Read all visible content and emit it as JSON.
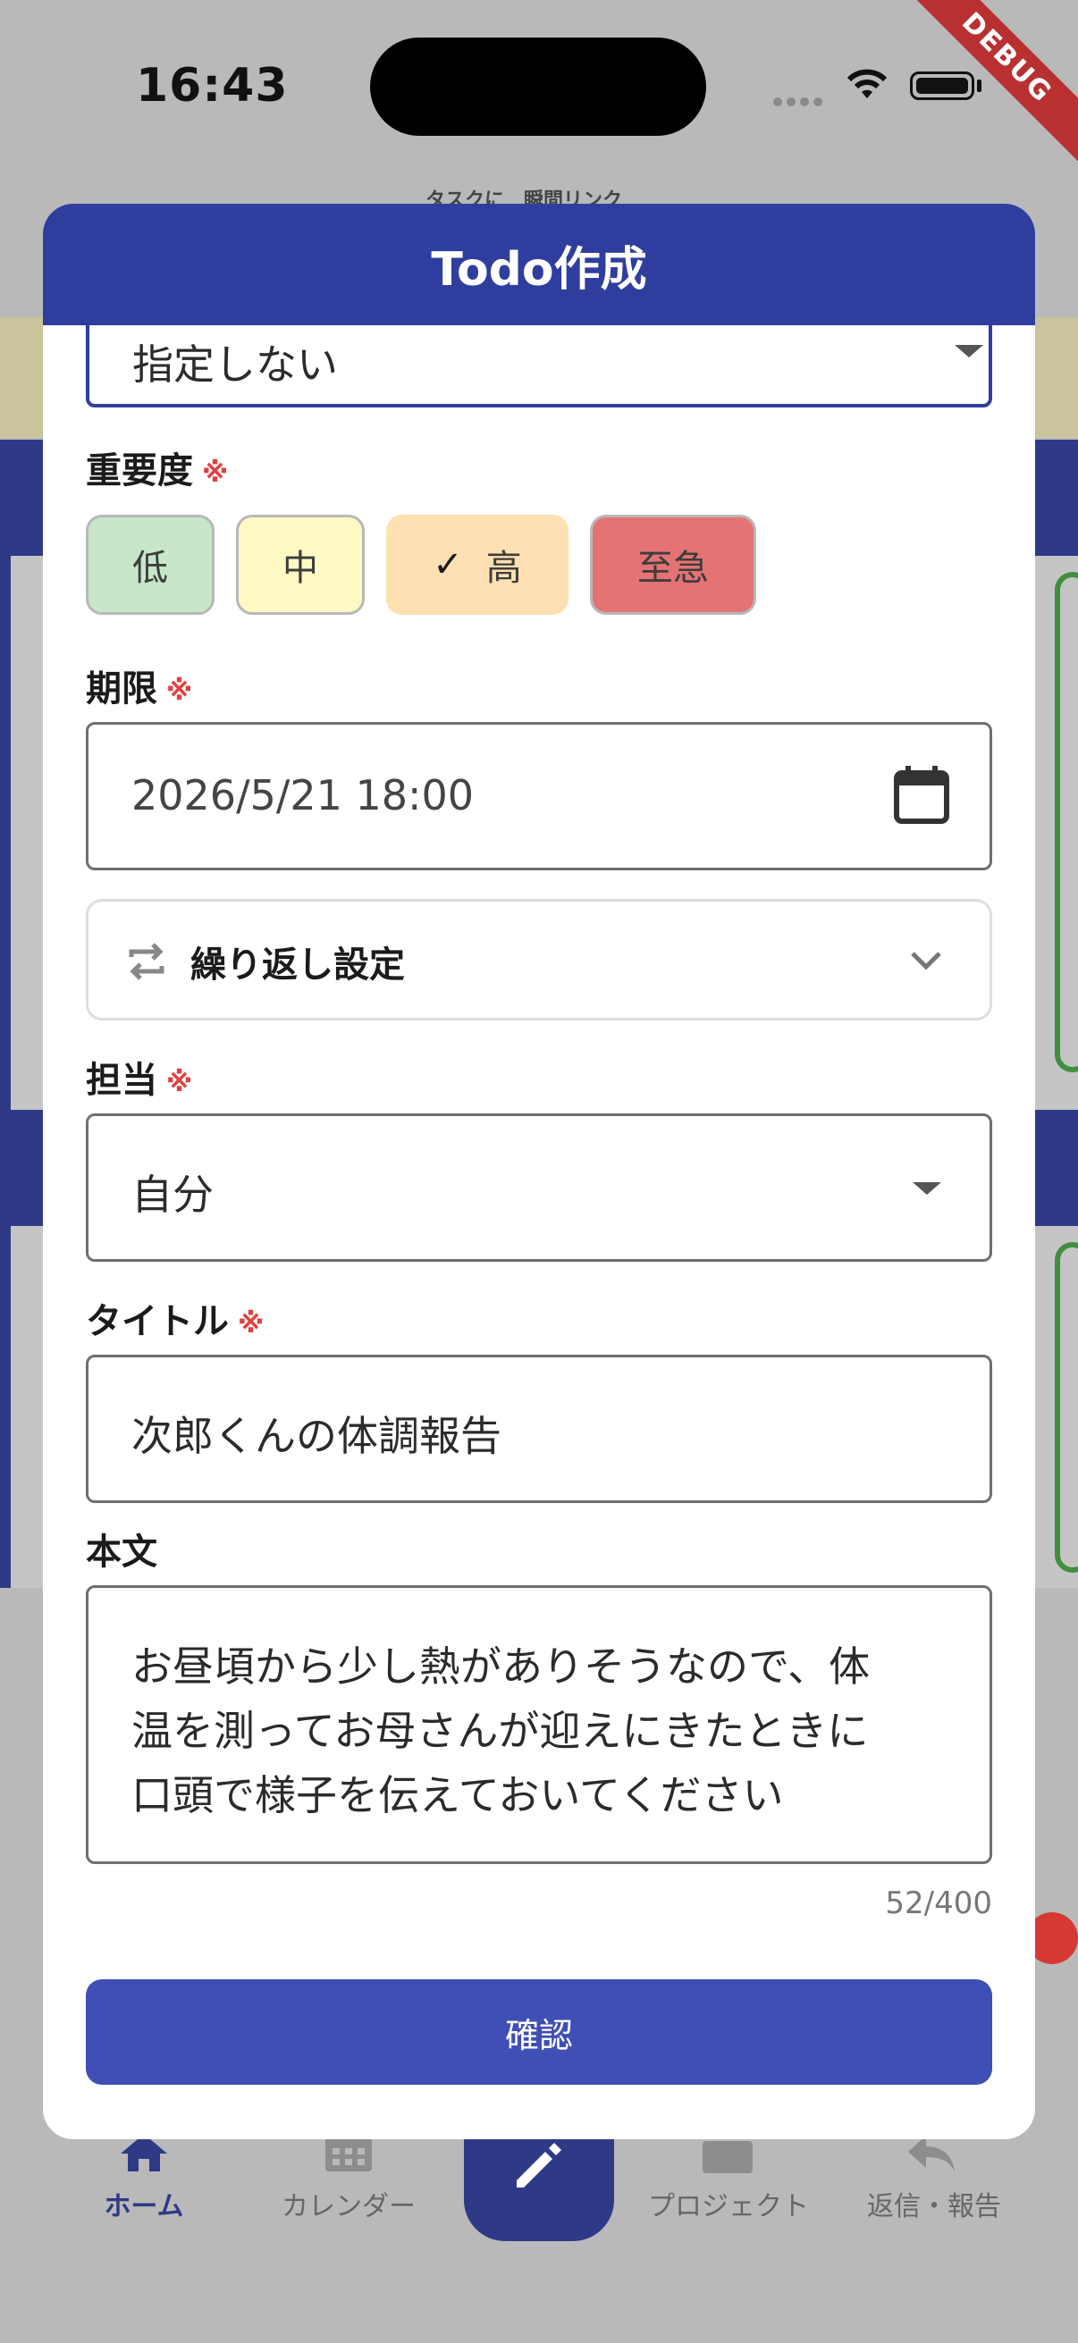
{
  "status_bar": {
    "time": "16:43",
    "debug_label": "DEBUG"
  },
  "background": {
    "banner_text": "タスクに　瞬間リンク"
  },
  "bottom_nav": {
    "items": [
      {
        "label": "ホーム",
        "icon": "home-icon",
        "active": true
      },
      {
        "label": "カレンダー",
        "icon": "calendar-icon",
        "active": false
      },
      {
        "label": "",
        "icon": "edit-icon",
        "active": false
      },
      {
        "label": "プロジェクト",
        "icon": "folder-icon",
        "active": false
      },
      {
        "label": "返信・報告",
        "icon": "reply-icon",
        "active": false
      }
    ]
  },
  "modal": {
    "title": "Todo作成",
    "top_select": {
      "value": "指定しない"
    },
    "importance": {
      "label": "重要度",
      "required_mark": "※",
      "options": [
        {
          "label": "低",
          "color": "#c8e6c9",
          "selected": false
        },
        {
          "label": "中",
          "color": "#fff9c4",
          "selected": false
        },
        {
          "label": "高",
          "color": "#ffe0b2",
          "selected": true
        },
        {
          "label": "至急",
          "color": "#e57373",
          "selected": false
        }
      ],
      "check_mark": "✓"
    },
    "deadline": {
      "label": "期限",
      "required_mark": "※",
      "value": "2026/5/21 18:00"
    },
    "repeat": {
      "label": "繰り返し設定"
    },
    "assignee": {
      "label": "担当",
      "required_mark": "※",
      "value": "自分"
    },
    "title_field": {
      "label": "タイトル",
      "required_mark": "※",
      "value": "次郎くんの体調報告"
    },
    "body": {
      "label": "本文",
      "lines": [
        "お昼頃から少し熱がありそうなので、体",
        "温を測ってお母さんが迎えにきたときに",
        "口頭で様子を伝えておいてください"
      ],
      "counter": "52/400"
    },
    "confirm_label": "確認"
  },
  "colors": {
    "primary": "#2f3e9e",
    "button": "#3f4fb5",
    "required": "#e04040"
  }
}
